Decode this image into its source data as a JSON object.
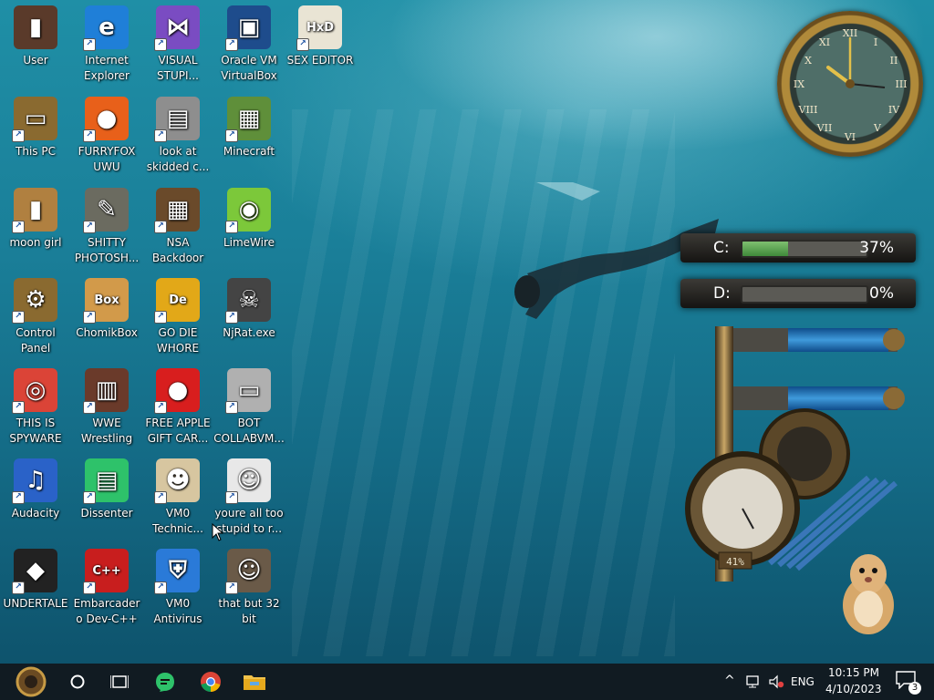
{
  "desktop_icons": [
    {
      "label": "User",
      "icon": "user-folder-icon"
    },
    {
      "label": "Internet Explorer",
      "icon": "edge-icon"
    },
    {
      "label": "VISUAL STUPI...",
      "icon": "visual-studio-icon"
    },
    {
      "label": "Oracle VM VirtualBox",
      "icon": "virtualbox-icon"
    },
    {
      "label": "SEX EDITOR",
      "icon": "hxd-icon"
    },
    {
      "label": "This PC",
      "icon": "this-pc-icon"
    },
    {
      "label": "FURRYFOX UWU",
      "icon": "firefox-icon"
    },
    {
      "label": "look at skidded c...",
      "icon": "copies-icon"
    },
    {
      "label": "Minecraft",
      "icon": "minecraft-icon"
    },
    {
      "label": "moon girl",
      "icon": "bag-icon"
    },
    {
      "label": "SHITTY PHOTOSH...",
      "icon": "gimp-icon"
    },
    {
      "label": "NSA Backdoor",
      "icon": "box-icon"
    },
    {
      "label": "LimeWire",
      "icon": "limewire-icon"
    },
    {
      "label": "Control Panel",
      "icon": "control-panel-icon"
    },
    {
      "label": "ChomikBox",
      "icon": "chomikbox-icon"
    },
    {
      "label": "GO DIE WHORE",
      "icon": "de-icon"
    },
    {
      "label": "NjRat.exe",
      "icon": "skull-icon"
    },
    {
      "label": "THIS IS SPYWARE",
      "icon": "chrome-icon"
    },
    {
      "label": "WWE Wrestling",
      "icon": "wrestling-icon"
    },
    {
      "label": "FREE APPLE GIFT CAR...",
      "icon": "apple-icon"
    },
    {
      "label": "BOT COLLABVM...",
      "icon": "monitor-icon"
    },
    {
      "label": "Audacity",
      "icon": "audacity-icon"
    },
    {
      "label": "Dissenter",
      "icon": "dissenter-icon"
    },
    {
      "label": "VM0 Technic...",
      "icon": "technician-icon"
    },
    {
      "label": "youre all too stupid to r...",
      "icon": "portrait-sketch-icon"
    },
    {
      "label": "UNDERTALE",
      "icon": "unity-icon"
    },
    {
      "label": "Embarcadero Dev-C++",
      "icon": "devcpp-icon"
    },
    {
      "label": "VM0 Antivirus",
      "icon": "shield-icon"
    },
    {
      "label": "that but 32 bit",
      "icon": "portrait-painting-icon"
    }
  ],
  "widgets": {
    "drives": [
      {
        "letter": "C:",
        "percent_text": "37%",
        "fill_fraction": 0.37
      },
      {
        "letter": "D:",
        "percent_text": "0%",
        "fill_fraction": 0.0
      }
    ],
    "gauge_text": "41%"
  },
  "taskbar": {
    "start": "steampunk-start-icon",
    "search": "cortana-circle-icon",
    "task_view": "task-view-icon",
    "pinned": [
      "dissenter-icon",
      "chrome-icon",
      "file-explorer-icon"
    ],
    "tray": {
      "chevron": "^",
      "language": "ENG",
      "time": "10:15 PM",
      "date": "4/10/2023",
      "notification_count": "3"
    }
  },
  "colors": {
    "taskbar": "#111b22",
    "water_top": "#1f8fa6",
    "water_bottom": "#0d4f68",
    "drive_fill": "#5aa24f"
  }
}
